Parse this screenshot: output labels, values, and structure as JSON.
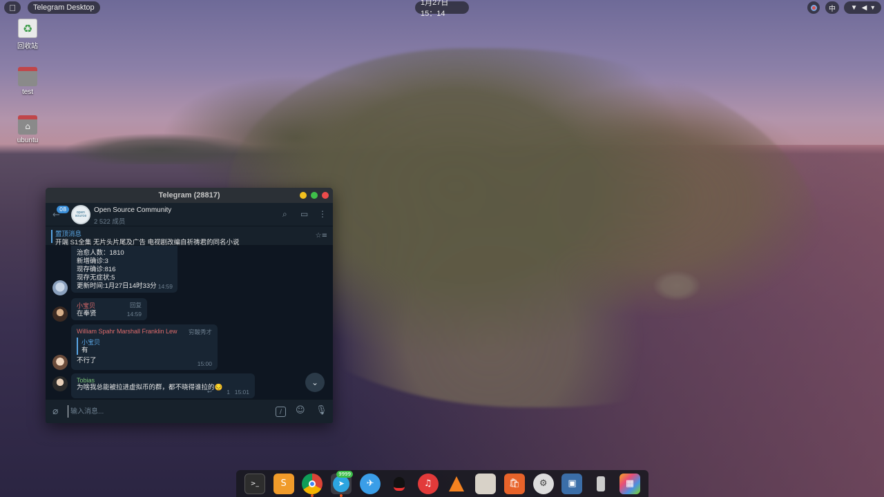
{
  "topbar": {
    "active_app": "Telegram Desktop",
    "clock": "1月27日  15：14",
    "input_method": "中"
  },
  "desktop_icons": [
    {
      "label": "回收站",
      "icon": "trash-icon"
    },
    {
      "label": "test",
      "icon": "folder-icon"
    },
    {
      "label": "ubuntu",
      "icon": "home-folder-icon"
    }
  ],
  "window": {
    "title": "Telegram (28817)",
    "unread_badge": "08",
    "chat": {
      "name": "Open Source Community",
      "members": "2 522 成员",
      "avatar_text": "open source"
    },
    "pinned": {
      "title": "置顶消息",
      "text": "开端 S1全集 无片头片尾及广告 电视剧改编自祈祷君的同名小说"
    },
    "messages": [
      {
        "lines": [
          "治愈人数：1810",
          "新增确诊:3",
          "现存确诊:816",
          "现存无症状:5",
          "更新时间:1月27日14时33分"
        ],
        "time": "14:59"
      },
      {
        "sender": "小宝贝",
        "text": "在奉贤",
        "reply_label": "回复",
        "time": "14:59"
      },
      {
        "sender": "William Spahr Marshall Franklin Lew",
        "tag": "穷酸秀才",
        "quote_sender": "小宝贝",
        "quote_text": "有",
        "text": "不行了",
        "time": "15:00"
      },
      {
        "sender": "Tobias",
        "text": "为啥我总能被拉进虚拟币的群，都不晓得谁拉的😔",
        "replies": "1",
        "time": "15:01"
      }
    ],
    "composer_placeholder": "输入消息..."
  },
  "dock": {
    "items": [
      "terminal-icon",
      "sublime-text-icon",
      "chrome-icon",
      "telegram-icon",
      "feishu-icon",
      "qq-icon",
      "netease-music-icon",
      "vlc-icon",
      "files-icon",
      "app-store-icon",
      "settings-icon",
      "screenshot-icon",
      "usb-icon",
      "app-grid-icon"
    ],
    "telegram_badge": "9999"
  },
  "colors": {
    "accent": "#5aa7e6",
    "window_bg": "#17212b",
    "chat_bg": "#0e1621",
    "bubble": "#182533",
    "name_red": "#e06c6c",
    "name_green": "#7ec77a"
  }
}
